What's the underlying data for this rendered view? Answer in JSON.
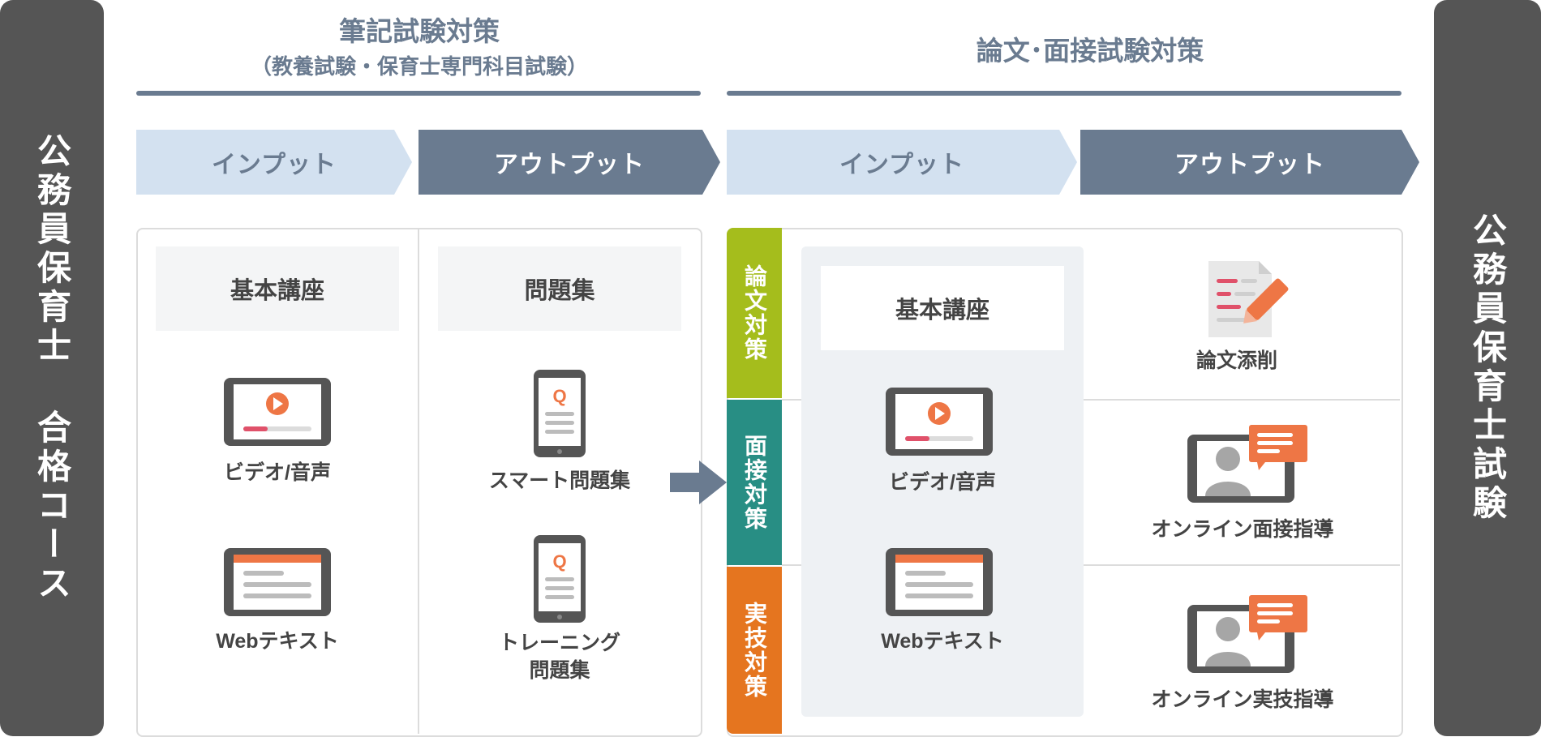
{
  "left_sidebar": {
    "text": "公務員保育士 合格コース"
  },
  "right_sidebar": {
    "text": "公務員保育士試験"
  },
  "written_exam": {
    "title": "筆記試験対策",
    "subtitle": "（教養試験・保育士専門科目試験）",
    "input_label": "インプット",
    "output_label": "アウトプット",
    "input_header": "基本講座",
    "output_header": "問題集",
    "input_items": [
      "ビデオ/音声",
      "Webテキスト"
    ],
    "output_items": [
      "スマート問題集",
      "トレーニング\n問題集"
    ]
  },
  "essay_interview": {
    "title": "論文･面接試験対策",
    "input_label": "インプット",
    "output_label": "アウトプット",
    "tabs": [
      "論文対策",
      "面接対策",
      "実技対策"
    ],
    "input_header": "基本講座",
    "input_items": [
      "ビデオ/音声",
      "Webテキスト"
    ],
    "output_items": [
      "論文添削",
      "オンライン面接指導",
      "オンライン実技指導"
    ]
  },
  "colors": {
    "sidebar": "#555555",
    "chevron_dark": "#6a7b90",
    "chevron_light": "#d3e1f0",
    "tab_essay": "#a5bd1c",
    "tab_interview": "#288e84",
    "tab_skill": "#e5751f",
    "accent_orange": "#ee7645",
    "accent_red": "#e0516a"
  },
  "icons": [
    "tablet-video-icon",
    "tablet-text-icon",
    "smartphone-quiz-icon",
    "document-pen-icon",
    "video-call-icon",
    "arrow-right-icon"
  ]
}
